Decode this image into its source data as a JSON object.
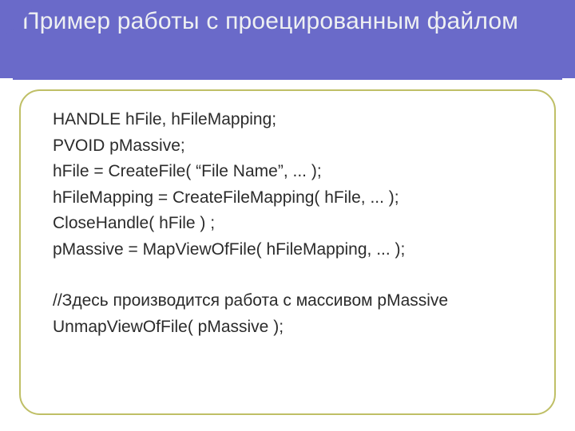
{
  "colors": {
    "accent": "#6a6ac9",
    "frame_border": "#bfbf66",
    "title_text": "#eef0f2",
    "body_text": "#2b2b2b"
  },
  "title": "Пример работы с проецированным файлом",
  "code": {
    "l1": "HANDLE hFile, hFileMapping;",
    "l2": "PVOID pMassive;",
    "l3": "hFile = CreateFile( “File Name”, ... );",
    "l4": "hFileMapping = CreateFileMapping( hFile, ... );",
    "l5": "CloseHandle( hFile ) ;",
    "l6": "pMassive = MapViewOfFile( hFileMapping, ... );",
    "l7": "",
    "l8": "//Здесь производится работа с массивом pMassive",
    "l9": "UnmapViewOfFile( pMassive );"
  }
}
